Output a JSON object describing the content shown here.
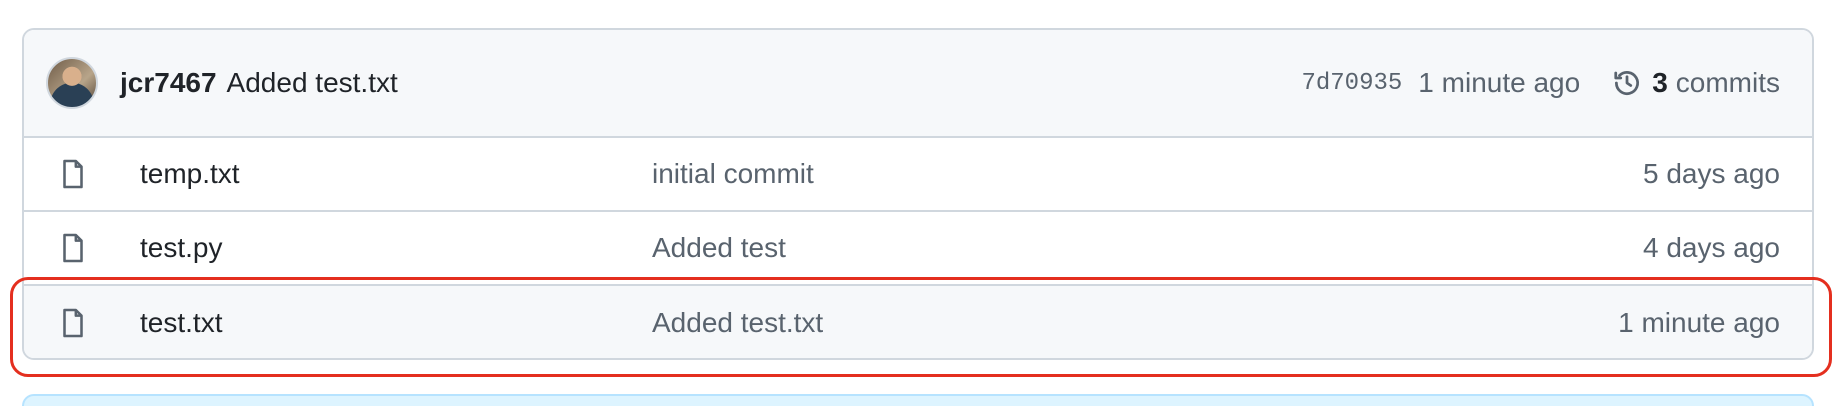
{
  "latest_commit": {
    "author": "jcr7467",
    "message": "Added test.txt",
    "sha": "7d70935",
    "time": "1 minute ago",
    "commits_count": "3",
    "commits_label": "commits"
  },
  "icons": {
    "avatar": "user-avatar",
    "history": "history-icon",
    "file": "file-icon"
  },
  "files": [
    {
      "name": "temp.txt",
      "commit": "initial commit",
      "time": "5 days ago"
    },
    {
      "name": "test.py",
      "commit": "Added test",
      "time": "4 days ago"
    },
    {
      "name": "test.txt",
      "commit": "Added test.txt",
      "time": "1 minute ago"
    }
  ],
  "colors": {
    "highlight_outline": "#e42f1f",
    "header_bg": "#f6f8fa",
    "border": "#d0d7de",
    "muted_text": "#59636e",
    "info_strip": "#ddf4ff"
  }
}
